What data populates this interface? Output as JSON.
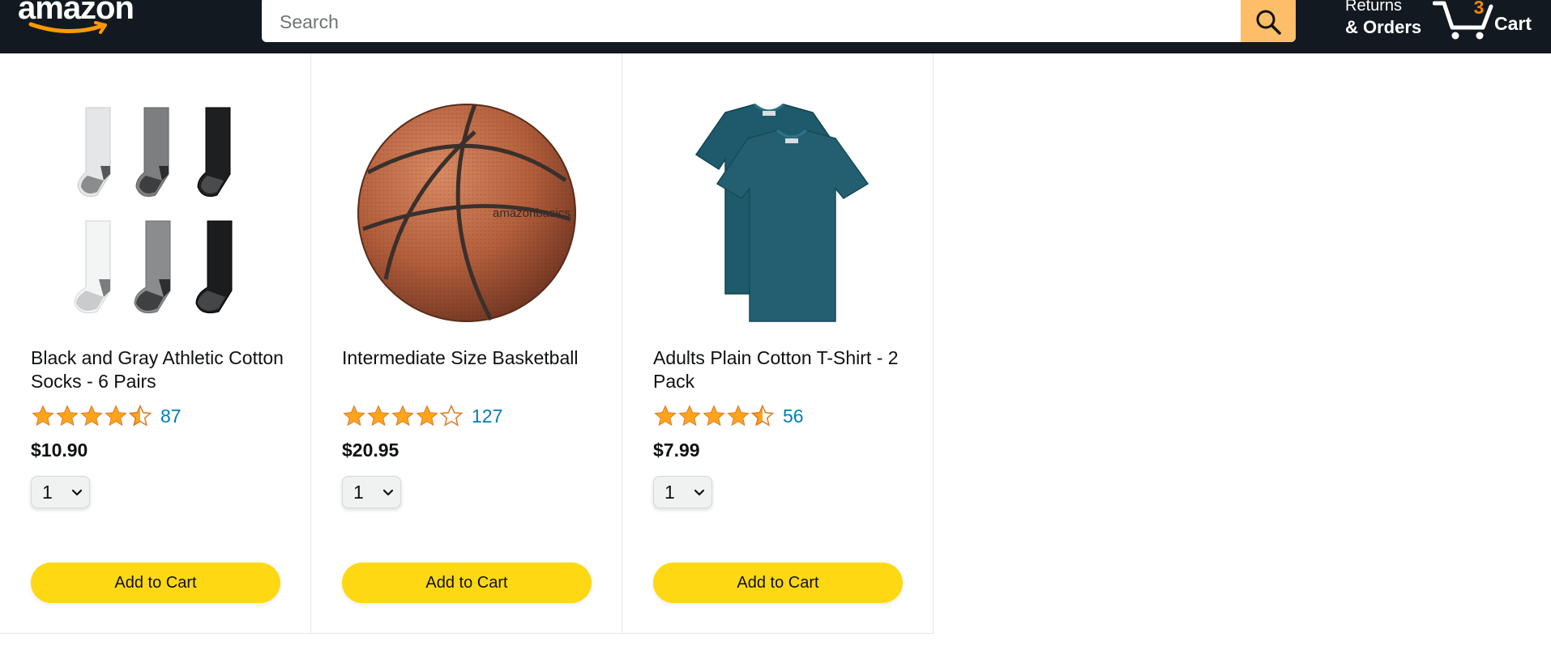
{
  "header": {
    "logo_text": "amazon",
    "search": {
      "placeholder": "Search",
      "value": ""
    },
    "returns_line1": "Returns",
    "returns_line2": "& Orders",
    "cart_count": "3",
    "cart_label": "Cart"
  },
  "products": [
    {
      "name": "Black and Gray Athletic Cotton Socks - 6 Pairs",
      "rating": 4.5,
      "rating_count": "87",
      "price": "$10.90",
      "quantity": "1",
      "add_to_cart_label": "Add to Cart",
      "image": "socks-image"
    },
    {
      "name": "Intermediate Size Basketball",
      "rating": 4.0,
      "rating_count": "127",
      "price": "$20.95",
      "quantity": "1",
      "add_to_cart_label": "Add to Cart",
      "image": "basketball-image",
      "image_brand_text": "amazonbasics"
    },
    {
      "name": "Adults Plain Cotton T-Shirt - 2 Pack",
      "rating": 4.5,
      "rating_count": "56",
      "price": "$7.99",
      "quantity": "1",
      "add_to_cart_label": "Add to Cart",
      "image": "tshirt-image"
    }
  ],
  "colors": {
    "header_bg": "#131921",
    "search_button": "#febd69",
    "cart_count": "#f08804",
    "star": "#ffa41c",
    "rating_link": "#017cb6",
    "add_to_cart": "#ffd814"
  }
}
